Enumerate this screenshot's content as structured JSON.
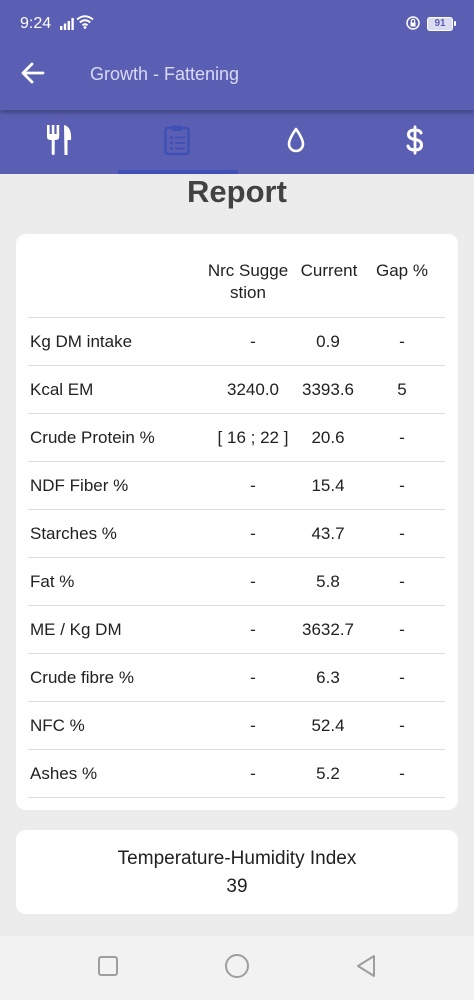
{
  "status_bar": {
    "time": "9:24",
    "battery": "91",
    "icons": [
      "signal-icon",
      "wifi-icon",
      "lock-icon",
      "battery-icon"
    ]
  },
  "app_bar": {
    "title": "Growth - Fattening",
    "back_icon": "arrow-left-icon"
  },
  "tabs": [
    {
      "icon": "fork-knife-icon",
      "active": false
    },
    {
      "icon": "clipboard-icon",
      "active": true
    },
    {
      "icon": "water-drop-icon",
      "active": false
    },
    {
      "icon": "dollar-icon",
      "active": false
    }
  ],
  "report": {
    "title": "Report",
    "columns": {
      "nrc_line1": "Nrc Sugge",
      "nrc_line2": "stion",
      "current": "Current",
      "gap": "Gap %"
    },
    "rows": [
      {
        "label": "Kg DM intake",
        "nrc": "-",
        "current": "0.9",
        "gap": "-"
      },
      {
        "label": "Kcal EM",
        "nrc": "3240.0",
        "current": "3393.6",
        "gap": "5"
      },
      {
        "label": "Crude Protein %",
        "nrc": "[ 16 ; 22 ]",
        "current": "20.6",
        "gap": "-"
      },
      {
        "label": "NDF Fiber %",
        "nrc": "-",
        "current": "15.4",
        "gap": "-"
      },
      {
        "label": "Starches %",
        "nrc": "-",
        "current": "43.7",
        "gap": "-"
      },
      {
        "label": "Fat %",
        "nrc": "-",
        "current": "5.8",
        "gap": "-"
      },
      {
        "label": "ME / Kg DM",
        "nrc": "-",
        "current": "3632.7",
        "gap": "-"
      },
      {
        "label": "Crude fibre %",
        "nrc": "-",
        "current": "6.3",
        "gap": "-"
      },
      {
        "label": "NFC %",
        "nrc": "-",
        "current": "52.4",
        "gap": "-"
      },
      {
        "label": "Ashes %",
        "nrc": "-",
        "current": "5.2",
        "gap": "-"
      }
    ]
  },
  "thi": {
    "label": "Temperature-Humidity Index",
    "value": "39"
  },
  "nav": {
    "icons": [
      "recent-apps-icon",
      "home-icon",
      "back-triangle-icon"
    ]
  },
  "colors": {
    "primary": "#5b5fb3",
    "indicator": "#3f51b5",
    "background": "#ececec"
  }
}
